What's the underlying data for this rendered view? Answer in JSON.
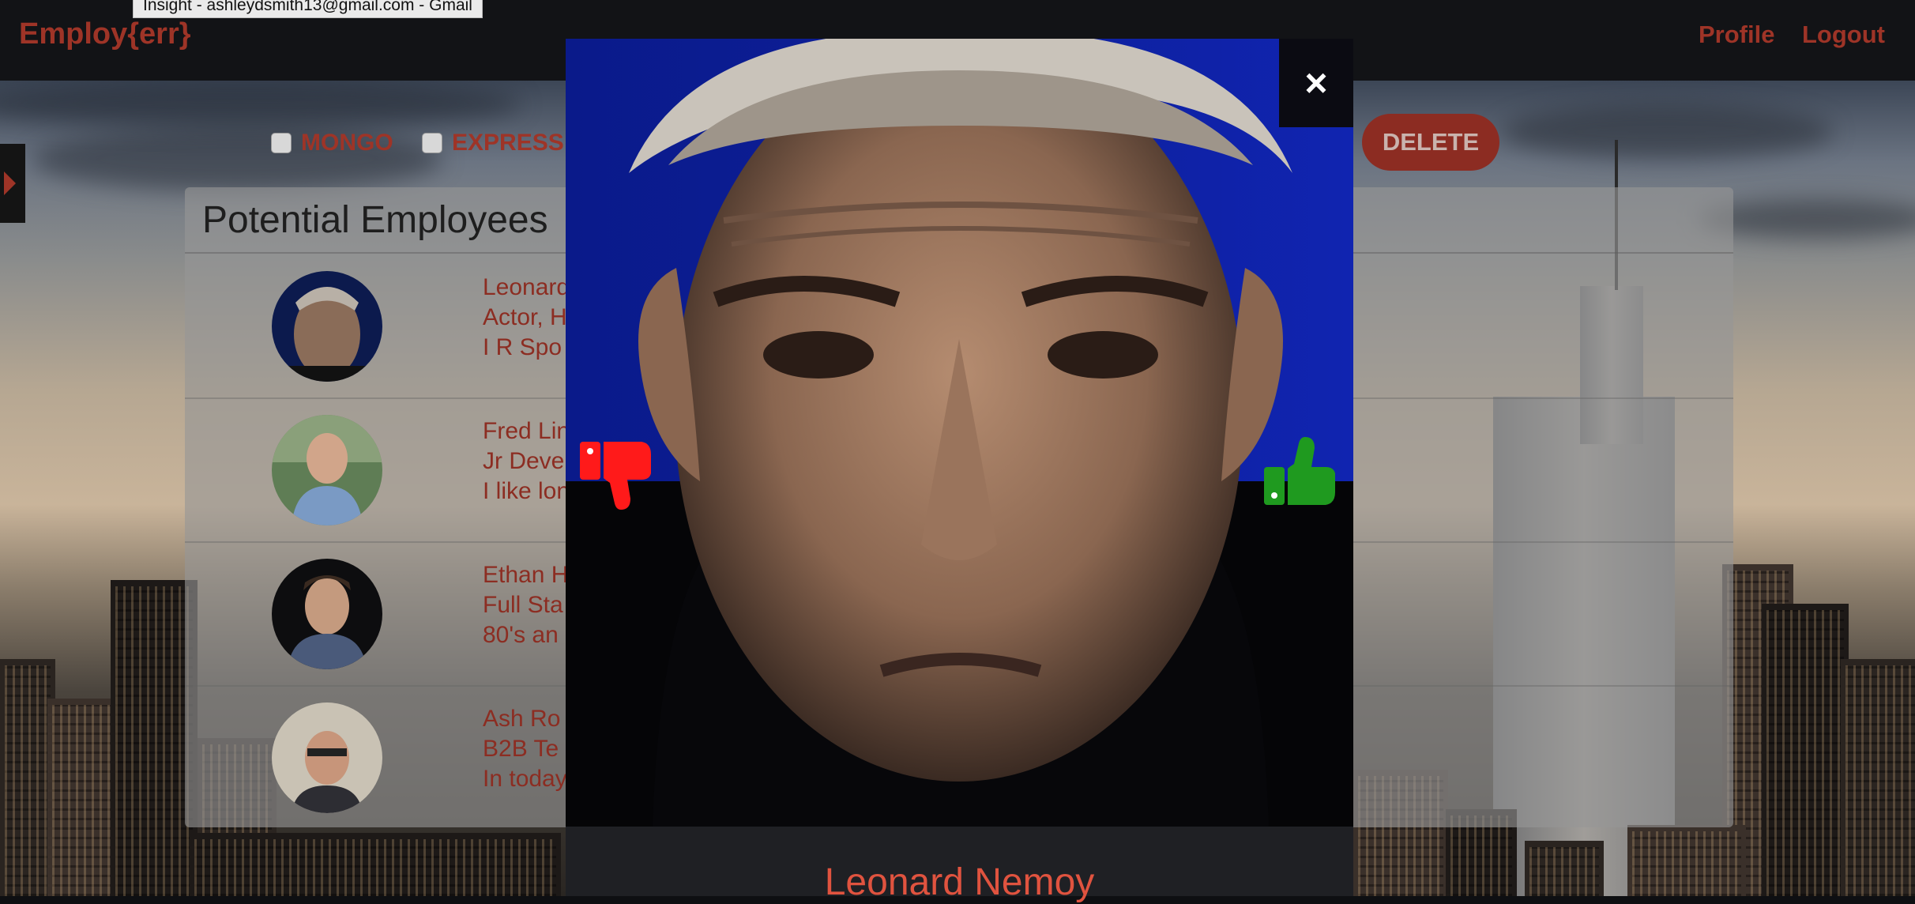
{
  "browser": {
    "tooltip": "Insight - ashleydsmith13@gmail.com - Gmail"
  },
  "navbar": {
    "brand": "Employ{err}",
    "links": [
      "Profile",
      "Logout"
    ]
  },
  "filters": {
    "items": [
      "MONGO",
      "EXPRESS"
    ],
    "delete_label": "DELETE"
  },
  "panel": {
    "title": "Potential Employees",
    "employees": [
      {
        "name": "Leonard",
        "role": "Actor, H",
        "bio": "I R Spo"
      },
      {
        "name": "Fred Lin",
        "role": "Jr Deve",
        "bio": "I like lon"
      },
      {
        "name": "Ethan H",
        "role": "Full Sta",
        "bio": "80's an"
      },
      {
        "name": "Ash Ro",
        "role": "B2B Te",
        "bio": "In today"
      }
    ]
  },
  "modal": {
    "close_label": "×",
    "name": "Leonard Nemoy",
    "thumbs_down_color": "#ff1a1a",
    "thumbs_up_color": "#1f9a1f"
  }
}
